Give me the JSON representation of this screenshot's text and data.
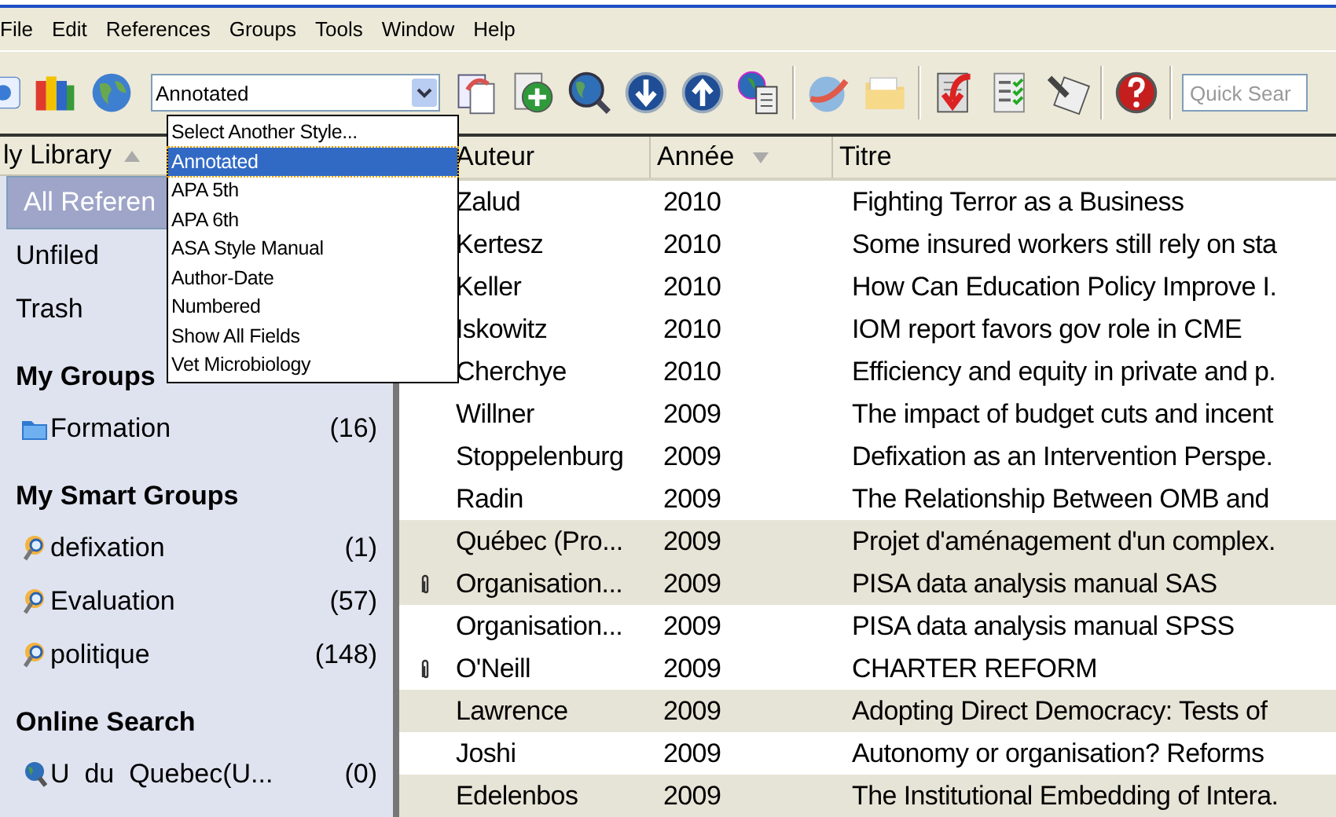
{
  "menu": [
    "File",
    "Edit",
    "References",
    "Groups",
    "Tools",
    "Window",
    "Help"
  ],
  "toolbar": {
    "style_select": {
      "value": "Annotated",
      "expanded": true
    },
    "quick_search": {
      "placeholder": "Quick Sear"
    }
  },
  "style_options": [
    {
      "label": "Select Another Style...",
      "selected": false
    },
    {
      "label": "Annotated",
      "selected": true
    },
    {
      "label": "APA 5th",
      "selected": false
    },
    {
      "label": "APA 6th",
      "selected": false
    },
    {
      "label": "ASA Style Manual",
      "selected": false
    },
    {
      "label": "Author-Date",
      "selected": false
    },
    {
      "label": "Numbered",
      "selected": false
    },
    {
      "label": "Show All Fields",
      "selected": false
    },
    {
      "label": "Vet Microbiology",
      "selected": false
    }
  ],
  "sidebar": {
    "header": {
      "label": "ly Library",
      "sorted": true,
      "ascending": true
    },
    "sections": [
      {
        "items": [
          {
            "kind": "plain",
            "label": "All Referen",
            "selected": true
          },
          {
            "kind": "plain",
            "label": "Unfiled",
            "selected": false
          },
          {
            "kind": "plain",
            "label": "Trash",
            "selected": false
          }
        ]
      },
      {
        "heading": "My Groups",
        "items": [
          {
            "kind": "folder",
            "label": "Formation",
            "count": "(16)",
            "selected": false
          }
        ]
      },
      {
        "heading": "My Smart Groups",
        "items": [
          {
            "kind": "smart",
            "label": "defixation",
            "count": "(1)",
            "selected": false
          },
          {
            "kind": "smart",
            "label": "Evaluation",
            "count": "(57)",
            "selected": false
          },
          {
            "kind": "smart",
            "label": "politique",
            "count": "(148)",
            "selected": false
          }
        ]
      },
      {
        "heading": "Online Search",
        "items": [
          {
            "kind": "online",
            "label": "U  du  Quebec(U...",
            "count": "(0)",
            "selected": false
          }
        ]
      }
    ]
  },
  "table": {
    "columns": [
      {
        "label": "Auteur",
        "sorted": false
      },
      {
        "label": "Année",
        "sorted": true,
        "ascending": false
      },
      {
        "label": "Titre",
        "sorted": false
      }
    ],
    "rows": [
      {
        "attachment": false,
        "author": "Zalud",
        "year": "2010",
        "title": "Fighting Terror as a Business",
        "selected": false
      },
      {
        "attachment": false,
        "author": "Kertesz",
        "year": "2010",
        "title": "Some insured workers still rely on sta",
        "selected": false
      },
      {
        "attachment": false,
        "author": "Keller",
        "year": "2010",
        "title": "How Can Education Policy Improve I.",
        "selected": false
      },
      {
        "attachment": false,
        "author": "Iskowitz",
        "year": "2010",
        "title": "IOM report favors gov role in CME",
        "selected": false
      },
      {
        "attachment": false,
        "author": "Cherchye",
        "year": "2010",
        "title": "Efficiency and equity in private and p.",
        "selected": false
      },
      {
        "attachment": false,
        "author": "Willner",
        "year": "2009",
        "title": "The impact of budget cuts and incent",
        "selected": false
      },
      {
        "attachment": false,
        "author": "Stoppelenburg",
        "year": "2009",
        "title": "Defixation as an Intervention Perspe.",
        "selected": false
      },
      {
        "attachment": false,
        "author": "Radin",
        "year": "2009",
        "title": "The Relationship Between OMB and",
        "selected": false
      },
      {
        "attachment": false,
        "author": "Québec (Pro...",
        "year": "2009",
        "title": "Projet d'aménagement d'un complex.",
        "selected": true
      },
      {
        "attachment": true,
        "author": "Organisation...",
        "year": "2009",
        "title": "PISA data analysis manual SAS",
        "selected": true
      },
      {
        "attachment": false,
        "author": "Organisation...",
        "year": "2009",
        "title": "PISA data analysis manual SPSS",
        "selected": false
      },
      {
        "attachment": true,
        "author": "O'Neill",
        "year": "2009",
        "title": "CHARTER REFORM",
        "selected": false
      },
      {
        "attachment": false,
        "author": "Lawrence",
        "year": "2009",
        "title": "Adopting Direct Democracy: Tests of",
        "selected": true
      },
      {
        "attachment": false,
        "author": "Joshi",
        "year": "2009",
        "title": "Autonomy or organisation? Reforms",
        "selected": false
      },
      {
        "attachment": false,
        "author": "Edelenbos",
        "year": "2009",
        "title": "The Institutional Embedding of Intera.",
        "selected": true
      }
    ]
  }
}
